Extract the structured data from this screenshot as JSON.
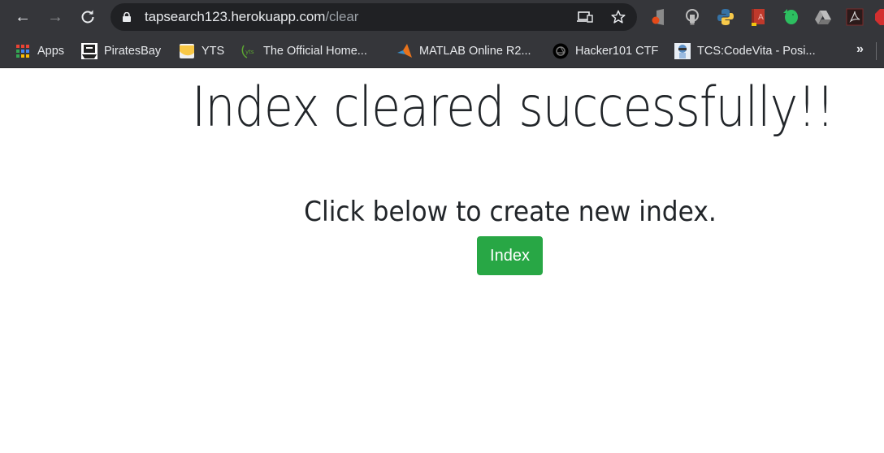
{
  "browser": {
    "url_host": "tapsearch123.herokuapp.com",
    "url_path": "/clear",
    "nav": {
      "back_icon": "←",
      "forward_icon": "→",
      "reload_icon": "↻"
    },
    "extensions": [
      "office-icon",
      "lightbulb-icon",
      "python-icon",
      "book-icon",
      "evernote-icon",
      "google-drive-icon",
      "acrobat-icon",
      "adblock-icon"
    ],
    "bookmarks": [
      {
        "label": "Apps",
        "icon": "apps-grid-icon"
      },
      {
        "label": "PiratesBay",
        "icon": "pirate-ship-icon"
      },
      {
        "label": "YTS",
        "icon": "yts-icon"
      },
      {
        "label": "The Official Home...",
        "icon": "yts-green-icon"
      },
      {
        "label": "MATLAB Online R2...",
        "icon": "matlab-icon"
      },
      {
        "label": "Hacker101 CTF",
        "icon": "hacker101-icon"
      },
      {
        "label": "TCS:CodeVita - Posi...",
        "icon": "codevita-icon"
      }
    ],
    "more_bookmarks": "»"
  },
  "page": {
    "heading": "Index cleared successfully!!",
    "subheading": "Click below to create new index.",
    "index_button_label": "Index",
    "colors": {
      "button": "#28a745",
      "text": "#212529"
    }
  }
}
